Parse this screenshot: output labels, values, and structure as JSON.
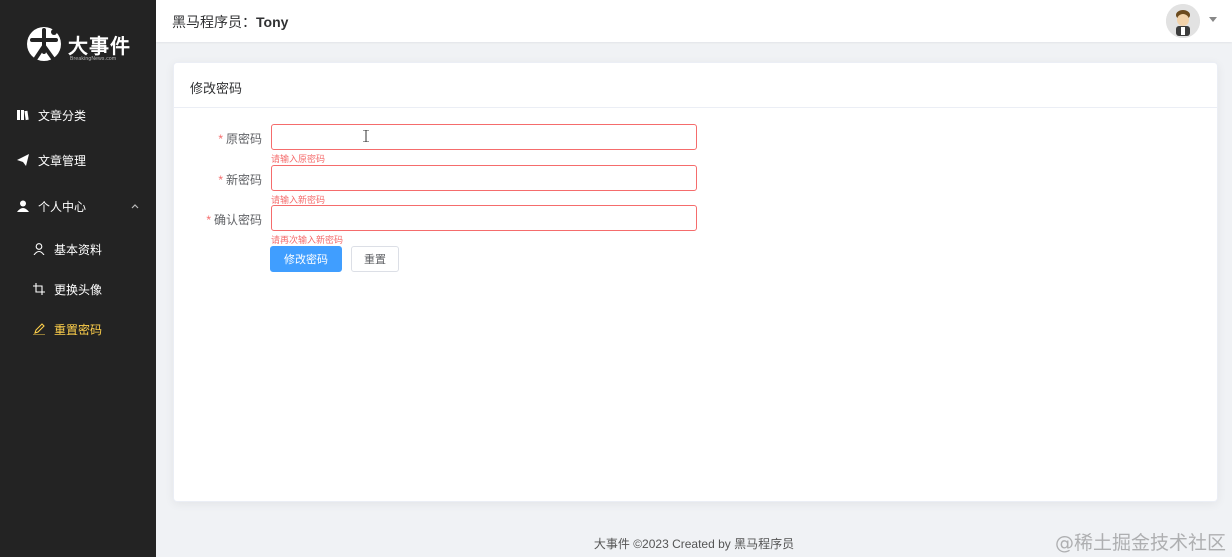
{
  "app": {
    "logo_text": "大事件",
    "logo_sub": "BreakingNews.com"
  },
  "sidebar": {
    "items": [
      {
        "label": "文章分类",
        "icon": "book-icon"
      },
      {
        "label": "文章管理",
        "icon": "paper-plane-icon"
      },
      {
        "label": "个人中心",
        "icon": "user-icon",
        "expanded": true
      },
      {
        "label": "基本资料",
        "icon": "user-outline-icon"
      },
      {
        "label": "更换头像",
        "icon": "crop-icon"
      },
      {
        "label": "重置密码",
        "icon": "edit-pen-icon",
        "active": true
      }
    ]
  },
  "header": {
    "prefix": "黑马程序员：",
    "username": "Tony"
  },
  "card": {
    "title": "修改密码"
  },
  "form": {
    "fields": [
      {
        "label": "原密码",
        "value": "",
        "error": "请输入原密码"
      },
      {
        "label": "新密码",
        "value": "",
        "error": "请输入新密码"
      },
      {
        "label": "确认密码",
        "value": "",
        "error": "请再次输入新密码"
      }
    ],
    "submit_label": "修改密码",
    "reset_label": "重置"
  },
  "footer": {
    "text": "大事件 ©2023 Created by 黑马程序员"
  },
  "watermark": "@稀土掘金技术社区",
  "colors": {
    "sidebar_bg": "#232323",
    "active": "#ffd04b",
    "primary": "#409eff",
    "error": "#f56c6c"
  }
}
